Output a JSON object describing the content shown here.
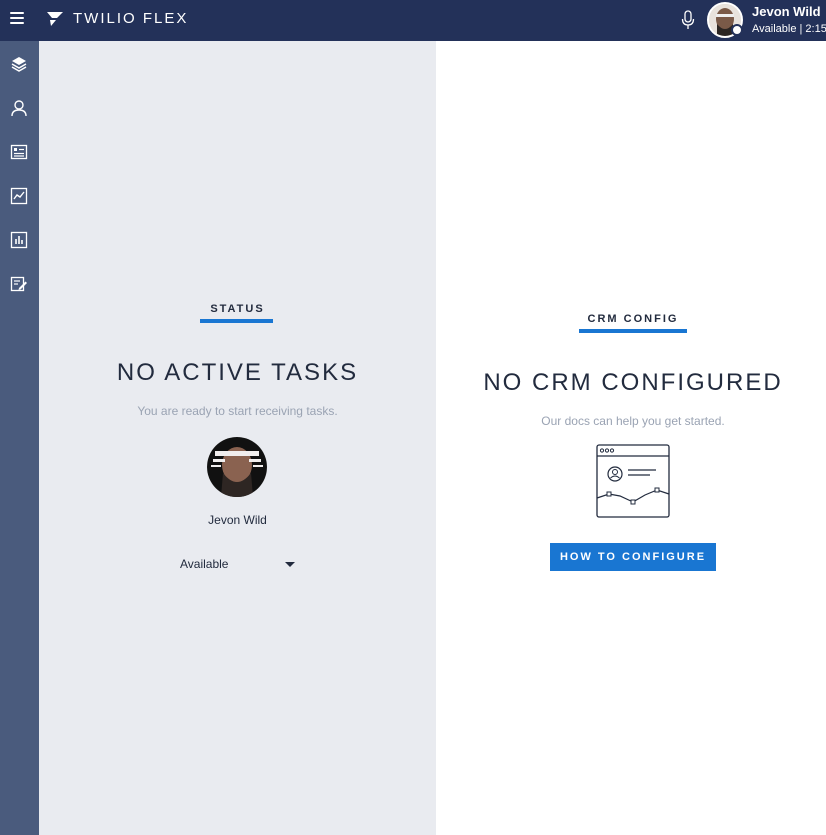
{
  "header": {
    "app_title": "TWILIO FLEX",
    "user_name": "Jevon Wild",
    "user_status": "Available | 2:15",
    "menu_icon": "hamburger-menu-icon",
    "mic_icon": "microphone-icon"
  },
  "sidebar": {
    "items": [
      {
        "icon": "layers-icon"
      },
      {
        "icon": "agents-icon"
      },
      {
        "icon": "task-list-icon"
      },
      {
        "icon": "analytics-icon"
      },
      {
        "icon": "reports-icon"
      },
      {
        "icon": "edit-form-icon"
      }
    ]
  },
  "status_panel": {
    "header": "STATUS",
    "title": "NO ACTIVE TASKS",
    "subtitle": "You are ready to start receiving tasks.",
    "agent_name": "Jevon Wild",
    "activity": "Available"
  },
  "crm_panel": {
    "header": "CRM CONFIG",
    "title": "NO CRM CONFIGURED",
    "subtitle": "Our docs can help you get started.",
    "button_label": "HOW TO CONFIGURE"
  },
  "colors": {
    "topbar": "#233159",
    "sidebar": "#4a5b7d",
    "left_panel_bg": "#e9ebf0",
    "accent": "#1976d2",
    "text_dark": "#222b3e",
    "text_muted": "#9aa3b3"
  }
}
